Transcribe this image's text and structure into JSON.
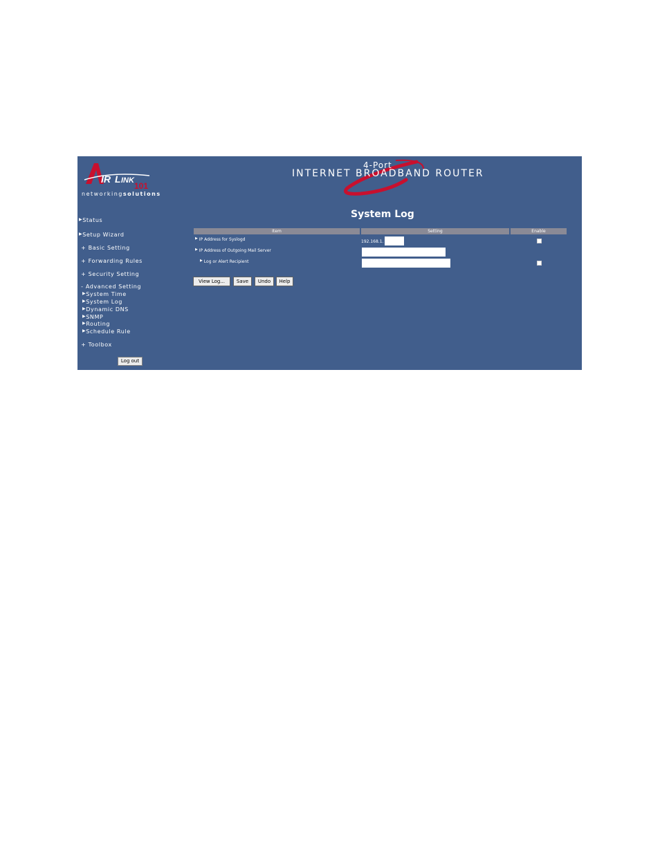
{
  "brand": {
    "logo_text": "AirLink",
    "logo_suffix": "101",
    "tagline_left": "networking",
    "tagline_right": "solutions"
  },
  "header": {
    "title_small": "4-Port",
    "title_main": "INTERNET BROADBAND ROUTER"
  },
  "sidebar": {
    "items": [
      {
        "label": "Status",
        "marker": "▶"
      },
      {
        "label": "Setup Wizard",
        "marker": "▶"
      },
      {
        "label": "Basic Setting",
        "marker": "+"
      },
      {
        "label": "Forwarding Rules",
        "marker": "+"
      },
      {
        "label": "Security Setting",
        "marker": "+"
      },
      {
        "label": "Advanced Setting",
        "marker": "-"
      },
      {
        "label": "Toolbox",
        "marker": "+"
      }
    ],
    "subitems": [
      {
        "label": "System Time"
      },
      {
        "label": "System Log"
      },
      {
        "label": "Dynamic DNS"
      },
      {
        "label": "SNMP"
      },
      {
        "label": "Routing"
      },
      {
        "label": "Schedule Rule"
      }
    ],
    "logout_label": "Log out"
  },
  "main": {
    "title": "System Log",
    "columns": [
      "Item",
      "Setting",
      "Enable"
    ],
    "rows": [
      {
        "label": "IP Address for Syslogd",
        "prefix": "192.168.1.",
        "value": ""
      },
      {
        "label": "IP Address of Outgoing Mail Server",
        "value": ""
      },
      {
        "label": "Log or Alert Recipient",
        "value": ""
      }
    ],
    "buttons": [
      "View Log...",
      "Save",
      "Undo",
      "Help"
    ]
  },
  "colors": {
    "panel_bg": "#415e8c",
    "header_cell_bg": "#8a8a96",
    "logo_red": "#c8102e"
  },
  "icons": [
    "airlink-logo",
    "router-swoosh",
    "triangle-bullet-icon"
  ]
}
